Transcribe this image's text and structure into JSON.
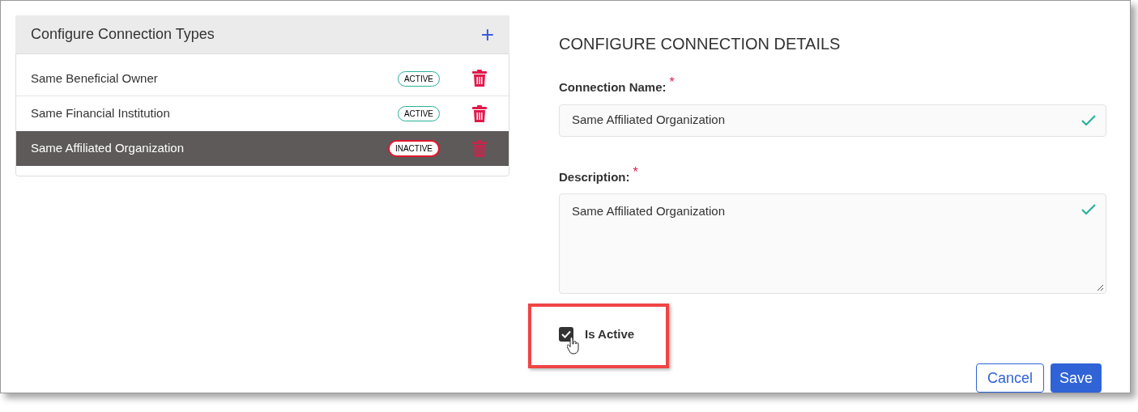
{
  "connection_types": {
    "title": "Configure Connection Types",
    "add_label": "+",
    "items": [
      {
        "name": "Same Beneficial Owner",
        "status": "ACTIVE",
        "active": true,
        "selected": false
      },
      {
        "name": "Same Financial Institution",
        "status": "ACTIVE",
        "active": true,
        "selected": false
      },
      {
        "name": "Same Affiliated Organization",
        "status": "INACTIVE",
        "active": false,
        "selected": true
      }
    ]
  },
  "details": {
    "title": "CONFIGURE CONNECTION DETAILS",
    "fields": [
      {
        "kind": "input",
        "label": "Connection Name:",
        "required_mark": "*",
        "value": "Same Affiliated Organization",
        "valid": true
      },
      {
        "kind": "textarea",
        "label": "Description:",
        "required_mark": "*",
        "value": "Same Affiliated Organization",
        "valid": true
      }
    ],
    "is_active": {
      "label": "Is Active",
      "checked": true,
      "highlighted": true
    },
    "buttons": [
      {
        "kind": "secondary",
        "label": "Cancel"
      },
      {
        "kind": "primary",
        "label": "Save"
      }
    ]
  }
}
